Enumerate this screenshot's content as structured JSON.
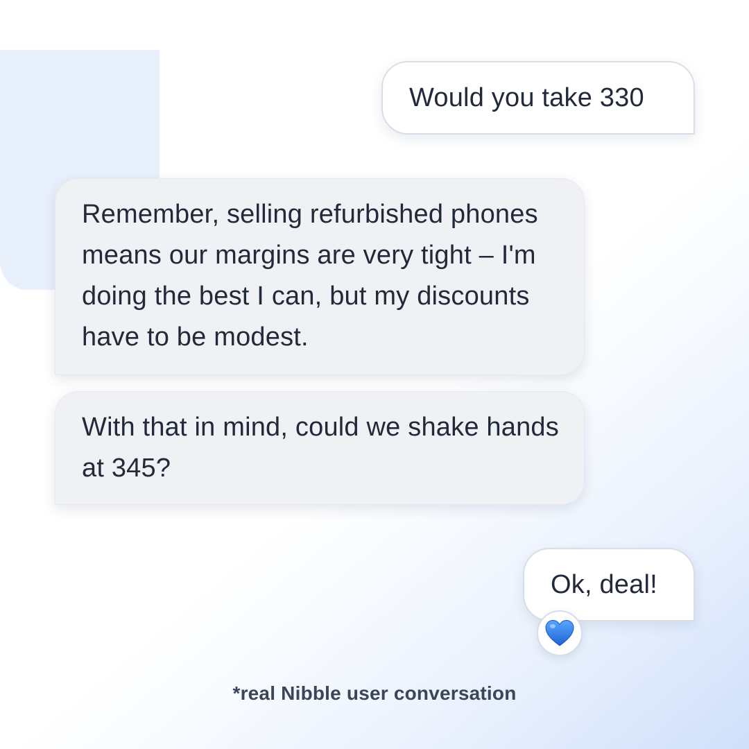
{
  "conversation": {
    "messages": [
      {
        "sender": "user",
        "text": "Would you take 330"
      },
      {
        "sender": "bot",
        "text": "Remember, selling refurbished phones means our margins are very tight – I'm doing the best I can, but my discounts have to be modest."
      },
      {
        "sender": "bot",
        "text": "With that in mind, could we shake hands at 345?"
      },
      {
        "sender": "user",
        "text": "Ok, deal!"
      }
    ],
    "reaction": {
      "icon": "blue-heart-icon",
      "color": "#2f7be8"
    }
  },
  "footnote": "*real Nibble user conversation",
  "colors": {
    "user_bubble": "#ffffff",
    "bot_bubble": "#eff1f5",
    "accent_block": "#e8f0fb",
    "text": "#222a3a"
  }
}
